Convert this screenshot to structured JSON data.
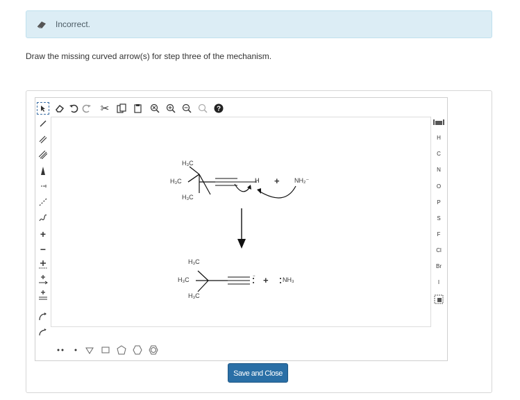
{
  "feedback": {
    "status": "Incorrect."
  },
  "question": {
    "prompt": "Draw the missing curved arrow(s) for step three of the mechanism."
  },
  "editor": {
    "top_toolbar_icons": [
      "select-icon",
      "erase-icon",
      "undo-icon",
      "redo-icon",
      "cut-icon",
      "copy-icon",
      "paste-icon",
      "zoom-reset-icon",
      "zoom-in-icon",
      "zoom-out-icon",
      "zoom-fit-icon",
      "help-icon"
    ],
    "left_toolbar_icons": [
      "single-bond-icon",
      "double-bond-icon",
      "triple-bond-icon",
      "wedge-bond-icon",
      "hash-bond-icon",
      "dashed-bond-icon",
      "wavy-bond-icon",
      "positive-charge-icon",
      "negative-charge-icon",
      "add-plus-icon",
      "reaction-arrow-icon",
      "equilibrium-arrow-icon",
      "resonance-arrow-icon",
      "curved-arrow-icon",
      "single-electron-arrow-icon"
    ],
    "bottom_toolbar_icons": [
      "lone-pair-icon",
      "radical-icon",
      "cyclopropane-icon",
      "cyclobutane-icon",
      "cyclopentane-icon",
      "cyclohexane-icon",
      "benzene-icon"
    ],
    "atoms": [
      "H",
      "C",
      "N",
      "O",
      "P",
      "S",
      "F",
      "Cl",
      "Br",
      "I"
    ],
    "periodic_table_icon": "periodic-table-icon",
    "template_icon": "template-icon"
  },
  "molecule": {
    "reactant": {
      "groups": [
        "H₃C",
        "H₃C",
        "H₃C"
      ],
      "h_atom": "H",
      "base": "NH₂⁻"
    },
    "product": {
      "groups": [
        "H₃C",
        "H₃C",
        "H₃C"
      ],
      "byproduct": "NH₃"
    },
    "plus": "+"
  },
  "actions": {
    "save_label": "Save and Close"
  },
  "colors": {
    "status_bg": "#dcedf5",
    "save_button": "#2a6fa6"
  }
}
